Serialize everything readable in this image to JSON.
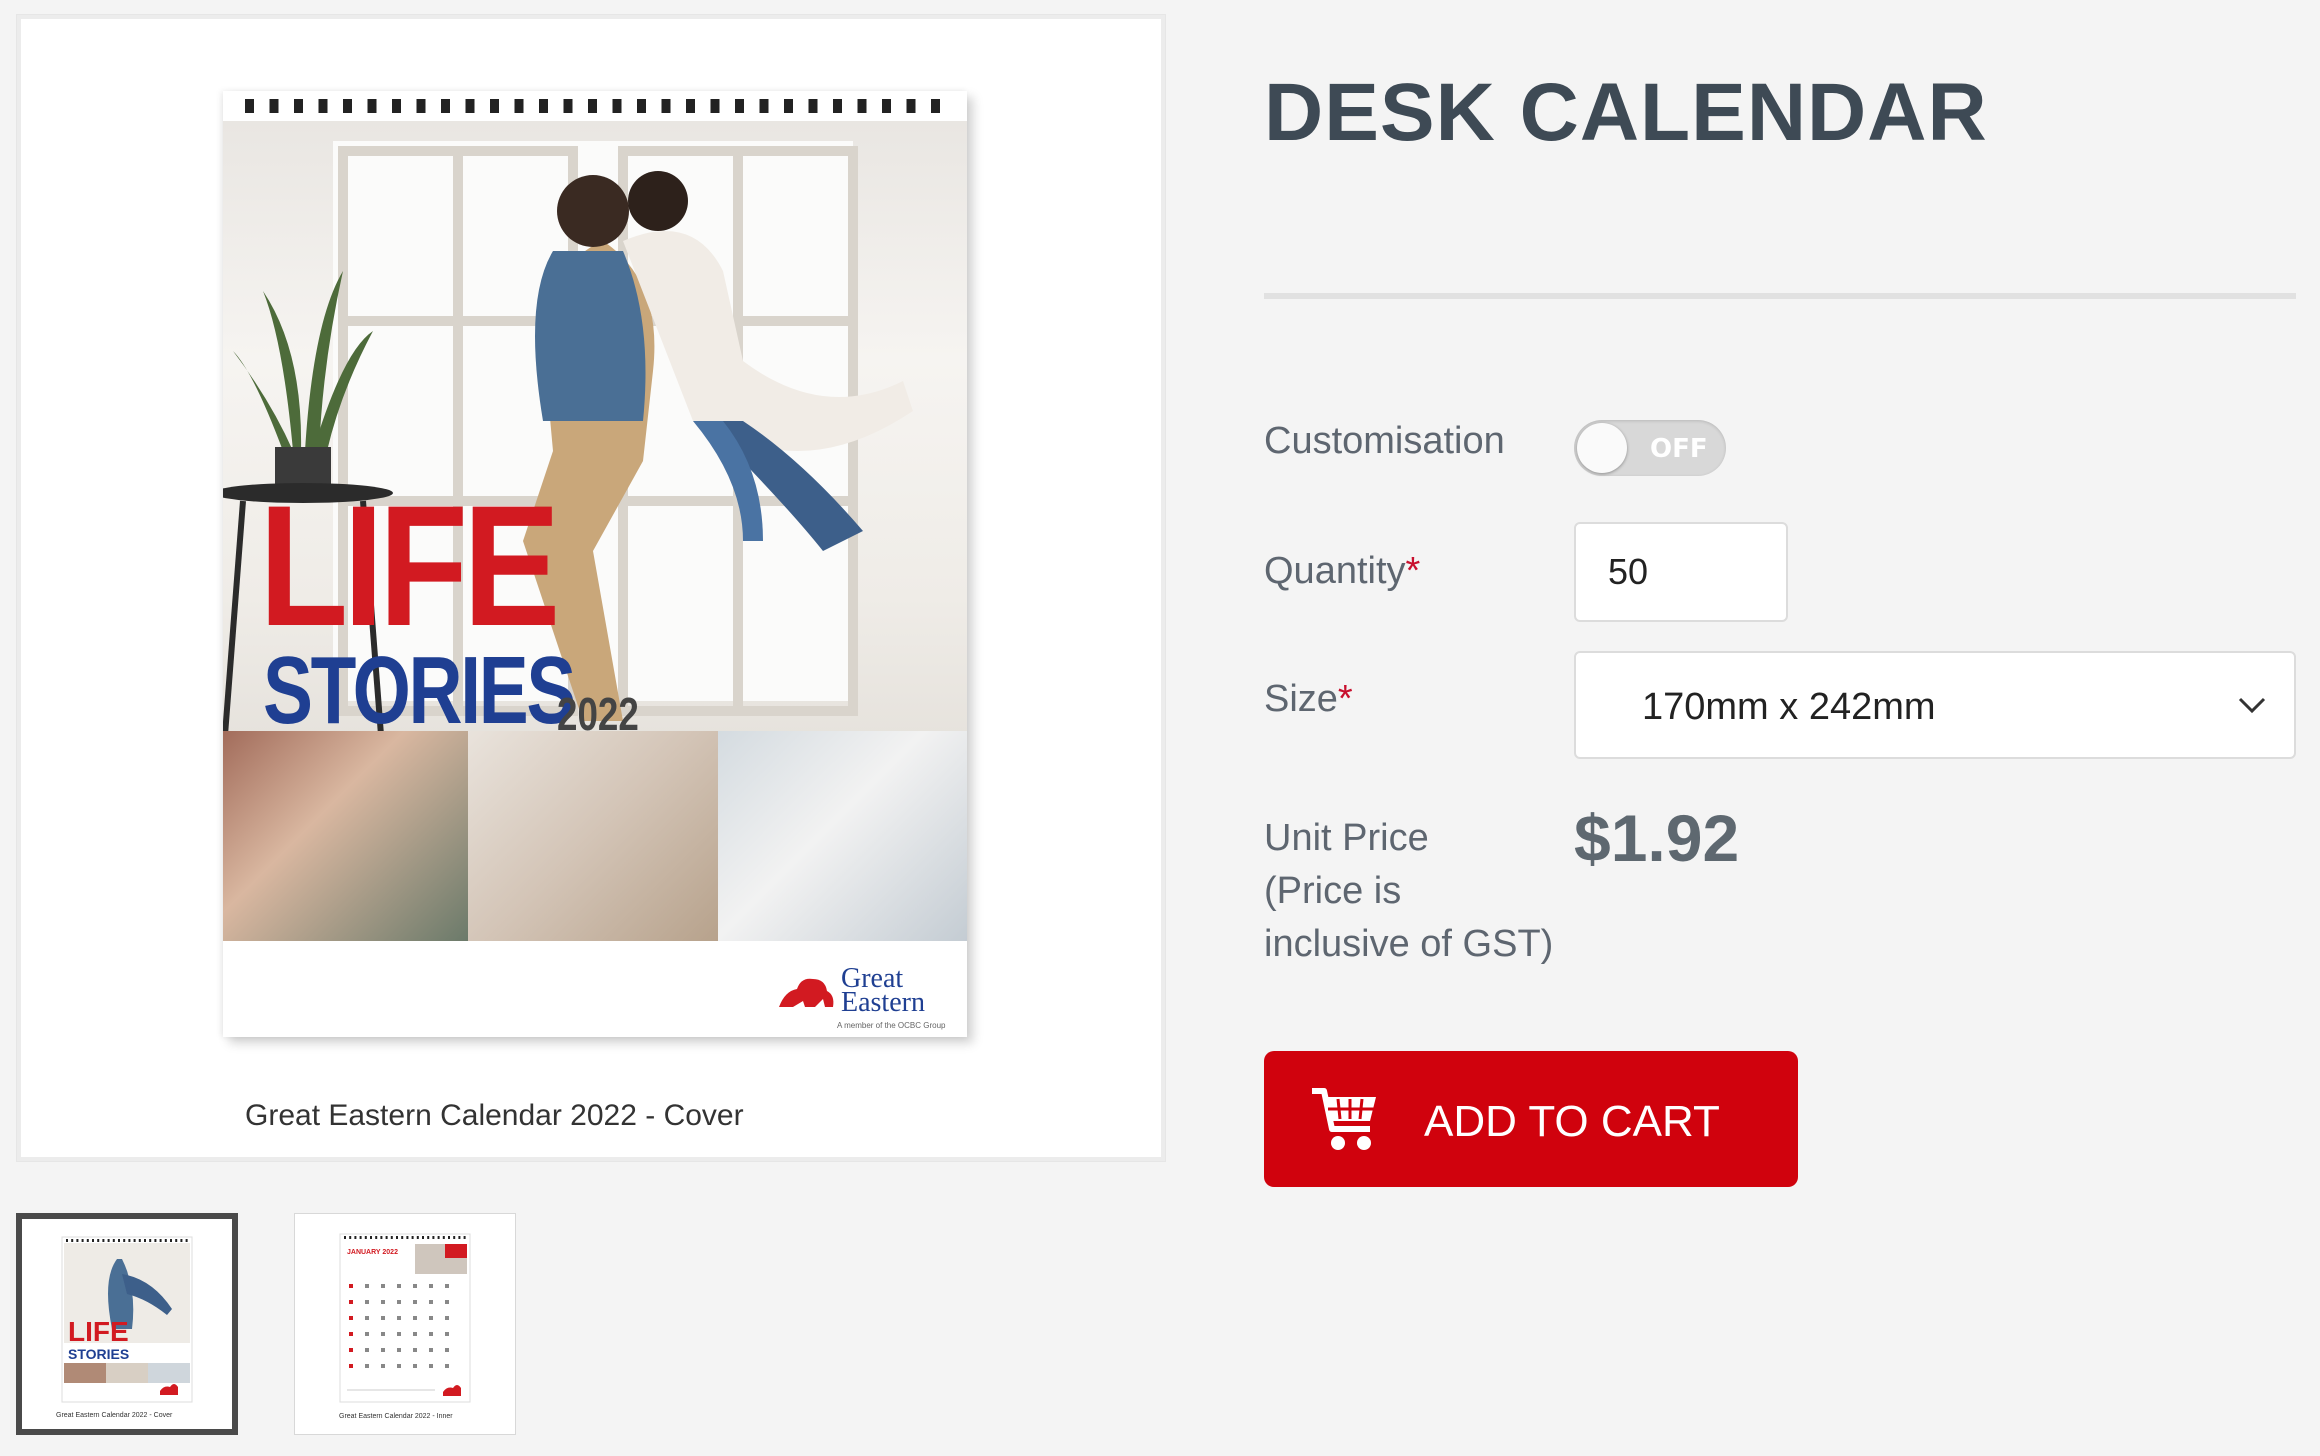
{
  "gallery": {
    "main_caption": "Great Eastern Calendar 2022 - Cover",
    "cover": {
      "title_line1": "LIFE",
      "title_line2": "STORIES",
      "year": "2022",
      "brand_line1": "Great",
      "brand_line2": "Eastern",
      "brand_tagline": "A member of the OCBC Group"
    },
    "thumbnails": [
      {
        "caption": "Great Eastern Calendar 2022 - Cover",
        "selected": true,
        "mini_title1": "LIFE",
        "mini_title2": "STORIES"
      },
      {
        "caption": "Great Eastern Calendar 2022 - Inner",
        "selected": false,
        "mini_month": "JANUARY 2022"
      }
    ]
  },
  "product": {
    "title": "DESK CALENDAR",
    "customisation": {
      "label": "Customisation",
      "state": "OFF"
    },
    "quantity": {
      "label": "Quantity",
      "required_mark": "*",
      "value": "50"
    },
    "size": {
      "label": "Size",
      "required_mark": "*",
      "selected": "170mm x 242mm"
    },
    "unit_price": {
      "label_line1": "Unit Price",
      "label_line2": "(Price is",
      "label_line3": "inclusive of GST)",
      "value": "$1.92"
    },
    "add_to_cart": {
      "label": "ADD TO CART",
      "icon": "cart-icon"
    }
  },
  "colors": {
    "accent_red": "#d0020d",
    "title_text": "#3e4a55",
    "brand_blue": "#1f3f92",
    "brand_red": "#d21a21",
    "background": "#f4f4f4"
  }
}
